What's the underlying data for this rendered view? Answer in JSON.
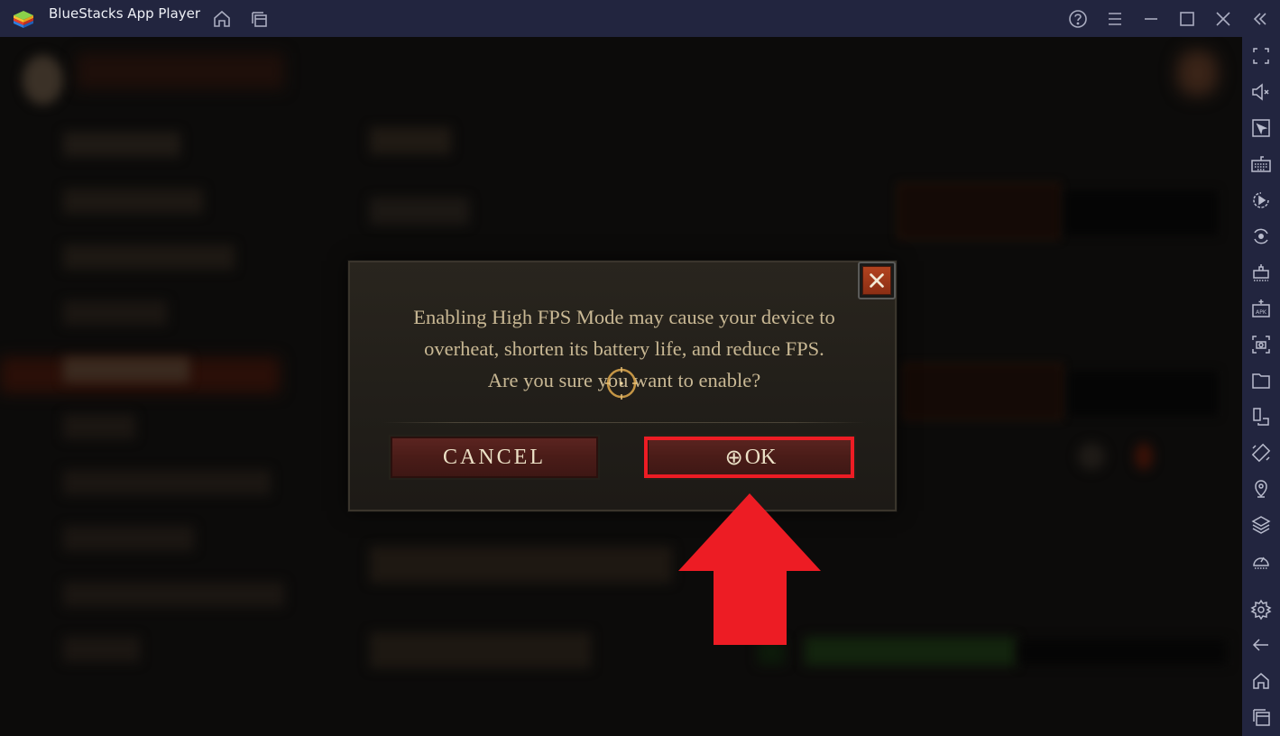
{
  "window": {
    "title": "BlueStacks App Player",
    "titlebar_icons": [
      "home-icon",
      "multi-instance-icon",
      "help-icon",
      "menu-icon",
      "minimize-icon",
      "maximize-icon",
      "close-icon",
      "collapse-sidebar-icon"
    ]
  },
  "sidebar": {
    "items": [
      {
        "name": "fullscreen-icon"
      },
      {
        "name": "volume-mute-icon"
      },
      {
        "name": "pointer-icon"
      },
      {
        "name": "keyboard-icon"
      },
      {
        "name": "macro-record-icon"
      },
      {
        "name": "sync-icon"
      },
      {
        "name": "performance-icon"
      },
      {
        "name": "install-apk-icon"
      },
      {
        "name": "screenshot-icon"
      },
      {
        "name": "folder-icon"
      },
      {
        "name": "multi-window-icon"
      },
      {
        "name": "rotate-icon"
      },
      {
        "name": "location-icon"
      },
      {
        "name": "layers-icon"
      },
      {
        "name": "speed-icon"
      },
      {
        "name": "settings-icon"
      },
      {
        "name": "back-icon"
      },
      {
        "name": "home-icon"
      },
      {
        "name": "recent-apps-icon"
      }
    ]
  },
  "dialog": {
    "message_line1": "Enabling High FPS Mode may cause your device to",
    "message_line2": "overheat, shorten its battery life, and reduce FPS.",
    "message_line3": "Are you sure you want to enable?",
    "cancel_label": "CANCEL",
    "ok_label": "OK",
    "ok_glyph": "⊕"
  },
  "annotation": {
    "highlight_color": "#ed1c24",
    "arrow_color": "#ed1c24"
  },
  "colors": {
    "titlebar_bg": "#22253f",
    "dialog_text": "#c9b894",
    "button_bg": "#4a1c18"
  }
}
